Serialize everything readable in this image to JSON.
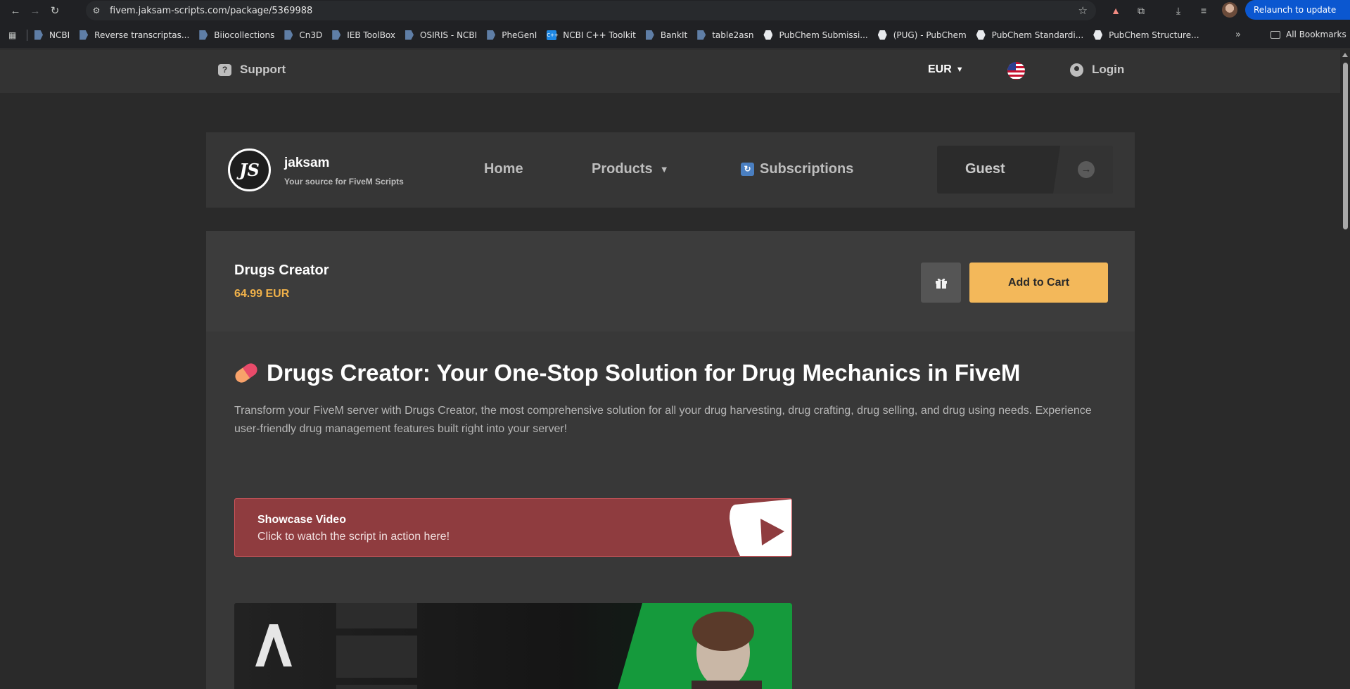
{
  "browser": {
    "url": "fivem.jaksam-scripts.com/package/5369988",
    "relaunch_label": "Relaunch to update",
    "bookmarks": [
      {
        "label": "NCBI",
        "icon": "page-icon"
      },
      {
        "label": "Reverse transcriptas...",
        "icon": "page-icon"
      },
      {
        "label": "Biiocollections",
        "icon": "page-icon"
      },
      {
        "label": "Cn3D",
        "icon": "page-icon"
      },
      {
        "label": "IEB ToolBox",
        "icon": "page-icon"
      },
      {
        "label": "OSIRIS - NCBI",
        "icon": "page-icon"
      },
      {
        "label": "PheGenI",
        "icon": "page-icon"
      },
      {
        "label": "NCBI C++ Toolkit",
        "icon": "cpp-icon"
      },
      {
        "label": "BankIt",
        "icon": "page-icon"
      },
      {
        "label": "table2asn",
        "icon": "page-icon"
      },
      {
        "label": "PubChem Submissi...",
        "icon": "pubchem-icon"
      },
      {
        "label": "(PUG) - PubChem",
        "icon": "pubchem-icon"
      },
      {
        "label": "PubChem Standardi...",
        "icon": "pubchem-icon"
      },
      {
        "label": "PubChem Structure...",
        "icon": "pubchem-icon"
      }
    ],
    "all_bookmarks_label": "All Bookmarks"
  },
  "topbar": {
    "support_label": "Support",
    "currency": "EUR",
    "login_label": "Login"
  },
  "header": {
    "logo_text": "JS",
    "brand_name": "jaksam",
    "tagline": "Your source for FiveM Scripts",
    "nav": {
      "home": "Home",
      "products": "Products",
      "subscriptions": "Subscriptions"
    },
    "guest_label": "Guest"
  },
  "product": {
    "title": "Drugs Creator",
    "price": "64.99 EUR",
    "add_to_cart": "Add to Cart",
    "headline_bold": "Drugs Creator",
    "headline_rest": ": Your One-Stop Solution for Drug Mechanics in FiveM",
    "description": "Transform your FiveM server with Drugs Creator, the most comprehensive solution for all your drug harvesting, drug crafting, drug selling, and drug using needs. Experience user-friendly drug management features built right into your server!",
    "video": {
      "title": "Showcase Video",
      "subtitle": "Click to watch the script in action here!"
    }
  },
  "colors": {
    "accent": "#f3b85a",
    "price": "#f1b24a",
    "video_bg": "#8f3c3f",
    "card_bg": "#383838"
  }
}
